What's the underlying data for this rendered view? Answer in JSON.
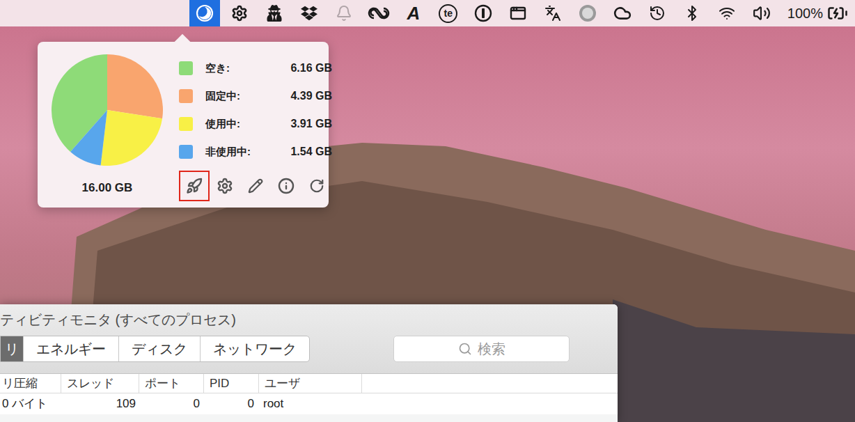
{
  "menubar": {
    "items": [
      {
        "selected": true,
        "disabled": false
      },
      {
        "selected": false,
        "disabled": false
      },
      {
        "selected": false,
        "disabled": false
      },
      {
        "selected": false,
        "disabled": false
      },
      {
        "selected": false,
        "disabled": true
      },
      {
        "selected": false,
        "disabled": false
      },
      {
        "selected": false,
        "disabled": false,
        "text": "A"
      },
      {
        "selected": false,
        "disabled": false,
        "text": "te"
      },
      {
        "selected": false,
        "disabled": false
      },
      {
        "selected": false,
        "disabled": false
      },
      {
        "selected": false,
        "disabled": false
      },
      {
        "selected": false,
        "disabled": false
      },
      {
        "selected": false,
        "disabled": false
      },
      {
        "selected": false,
        "disabled": false
      },
      {
        "selected": false,
        "disabled": false
      },
      {
        "selected": false,
        "disabled": false
      },
      {
        "selected": false,
        "disabled": false
      }
    ],
    "battery": "100%"
  },
  "memory_popover": {
    "legend": [
      {
        "label": "空き:",
        "value": "6.16 GB",
        "color": "#8edb78"
      },
      {
        "label": "固定中:",
        "value": "4.39 GB",
        "color": "#f9a56e"
      },
      {
        "label": "使用中:",
        "value": "3.91 GB",
        "color": "#f8f046"
      },
      {
        "label": "非使用中:",
        "value": "1.54 GB",
        "color": "#58a6ec"
      }
    ],
    "chart": {
      "values": [
        6.16,
        4.39,
        3.91,
        1.54
      ]
    },
    "total": "16.00 GB",
    "buttons": [
      {
        "highlighted": true
      },
      {
        "highlighted": false
      },
      {
        "highlighted": false
      },
      {
        "highlighted": false
      },
      {
        "highlighted": false
      }
    ]
  },
  "activity_monitor": {
    "title": "ティビティモニタ (すべてのプロセス)",
    "tabs": [
      {
        "label": "リ",
        "selected": true
      },
      {
        "label": "エネルギー",
        "selected": false
      },
      {
        "label": "ディスク",
        "selected": false
      },
      {
        "label": "ネットワーク",
        "selected": false
      }
    ],
    "search": {
      "placeholder": "検索"
    },
    "columns": [
      "リ圧縮",
      "スレッド",
      "ポート",
      "PID",
      "ユーザ"
    ],
    "rows": [
      [
        "0 バイト",
        "109",
        "0",
        "0",
        "root"
      ]
    ]
  }
}
